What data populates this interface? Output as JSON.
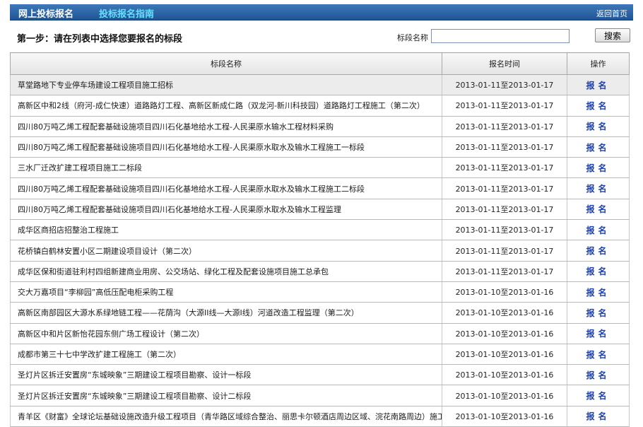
{
  "header": {
    "title": "网上投标报名",
    "guide_link": "投标报名指南",
    "home_link": "返回首页"
  },
  "stepbar": {
    "step_label": "第一步：请在列表中选择您要报名的标段",
    "search_label": "标段名称",
    "search_value": "",
    "search_button": "搜索"
  },
  "table": {
    "columns": [
      "标段名称",
      "报名时间",
      "操作"
    ],
    "rows": [
      {
        "name": "草堂路地下专业停车场建设工程项目施工招标",
        "time": "2013-01-11至2013-01-17",
        "action": "报名"
      },
      {
        "name": "高新区中和2线（府河-成仁快速）道路路灯工程、高新区新成仁路（双龙河-新川科技园）道路路灯工程施工（第二次）",
        "time": "2013-01-11至2013-01-17",
        "action": "报名"
      },
      {
        "name": "四川80万吨乙烯工程配套基础设施项目四川石化基地给水工程-人民渠原水输水工程材料采购",
        "time": "2013-01-11至2013-01-17",
        "action": "报名"
      },
      {
        "name": "四川80万吨乙烯工程配套基础设施项目四川石化基地给水工程-人民渠原水取水及输水工程施工一标段",
        "time": "2013-01-11至2013-01-17",
        "action": "报名"
      },
      {
        "name": "三水厂迁改扩建工程项目施工二标段",
        "time": "2013-01-11至2013-01-17",
        "action": "报名"
      },
      {
        "name": "四川80万吨乙烯工程配套基础设施项目四川石化基地给水工程-人民渠原水取水及输水工程施工二标段",
        "time": "2013-01-11至2013-01-17",
        "action": "报名"
      },
      {
        "name": "四川80万吨乙烯工程配套基础设施项目四川石化基地给水工程-人民渠原水取水及输水工程监理",
        "time": "2013-01-11至2013-01-17",
        "action": "报名"
      },
      {
        "name": "成华区商招店招整治工程施工",
        "time": "2013-01-11至2013-01-17",
        "action": "报名"
      },
      {
        "name": "花桥镇白鹤林安置小区二期建设项目设计（第二次）",
        "time": "2013-01-11至2013-01-17",
        "action": "报名"
      },
      {
        "name": "成华区保和街道驻利村四组新建商业用房、公交场站、绿化工程及配套设施项目施工总承包",
        "time": "2013-01-11至2013-01-17",
        "action": "报名"
      },
      {
        "name": "交大万嘉项目“李柳园”高低压配电柜采购工程",
        "time": "2013-01-10至2013-01-16",
        "action": "报名"
      },
      {
        "name": "高新区南部园区大源水系绿地链工程——花荫沟（大源II线—大源I线）河道改造工程监理（第二次）",
        "time": "2013-01-10至2013-01-16",
        "action": "报名"
      },
      {
        "name": "高新区中和片区新怡花园东侧广场工程设计（第二次）",
        "time": "2013-01-10至2013-01-16",
        "action": "报名"
      },
      {
        "name": "成都市第三十七中学改扩建工程施工（第二次）",
        "time": "2013-01-10至2013-01-16",
        "action": "报名"
      },
      {
        "name": "圣灯片区拆迁安置房“东城映象”三期建设工程项目勘察、设计一标段",
        "time": "2013-01-10至2013-01-16",
        "action": "报名"
      },
      {
        "name": "圣灯片区拆迁安置房“东城映象”三期建设工程项目勘察、设计二标段",
        "time": "2013-01-10至2013-01-16",
        "action": "报名"
      },
      {
        "name": "青羊区《财富》全球论坛基础设施改造升级工程项目（青华路区域综合整治、丽思卡尔顿酒店周边区域、浣花南路周边）施工",
        "time": "2013-01-10至2013-01-16",
        "action": "报名"
      }
    ]
  }
}
